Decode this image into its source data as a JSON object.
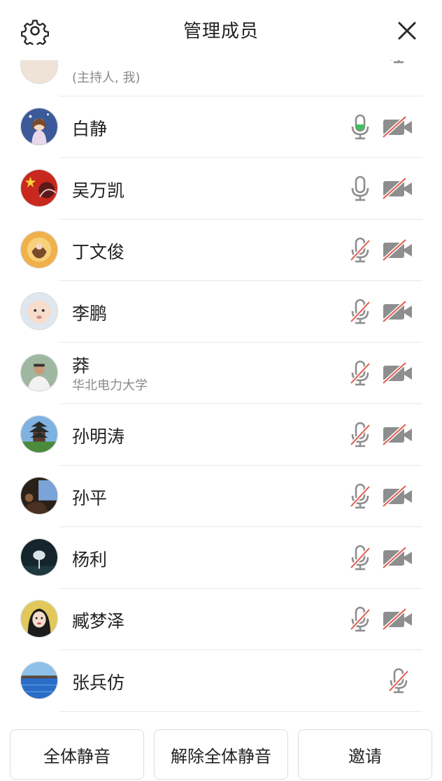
{
  "header": {
    "title": "管理成员",
    "settings_icon": "gear-icon",
    "close_icon": "close-icon"
  },
  "members": [
    {
      "name": "",
      "sub": "(主持人, 我)",
      "mic": "muted",
      "camera": "none",
      "partial": true
    },
    {
      "name": "白静",
      "sub": "",
      "mic": "speaking",
      "camera": "off"
    },
    {
      "name": "吴万凯",
      "sub": "",
      "mic": "on",
      "camera": "off"
    },
    {
      "name": "丁文俊",
      "sub": "",
      "mic": "muted",
      "camera": "off"
    },
    {
      "name": "李鹏",
      "sub": "",
      "mic": "muted",
      "camera": "off"
    },
    {
      "name": "莽",
      "sub": "华北电力大学",
      "mic": "muted",
      "camera": "off"
    },
    {
      "name": "孙明涛",
      "sub": "",
      "mic": "muted",
      "camera": "off"
    },
    {
      "name": "孙平",
      "sub": "",
      "mic": "muted",
      "camera": "off"
    },
    {
      "name": "杨利",
      "sub": "",
      "mic": "muted",
      "camera": "off"
    },
    {
      "name": "臧梦泽",
      "sub": "",
      "mic": "muted",
      "camera": "off"
    },
    {
      "name": "张兵仿",
      "sub": "",
      "mic": "muted",
      "camera": "none"
    }
  ],
  "footer": {
    "mute_all": "全体静音",
    "unmute_all": "解除全体静音",
    "invite": "邀请"
  },
  "colors": {
    "muted_slash": "#e05a4e",
    "speaking": "#3cc25a",
    "icon_gray": "#8e8e8e"
  }
}
